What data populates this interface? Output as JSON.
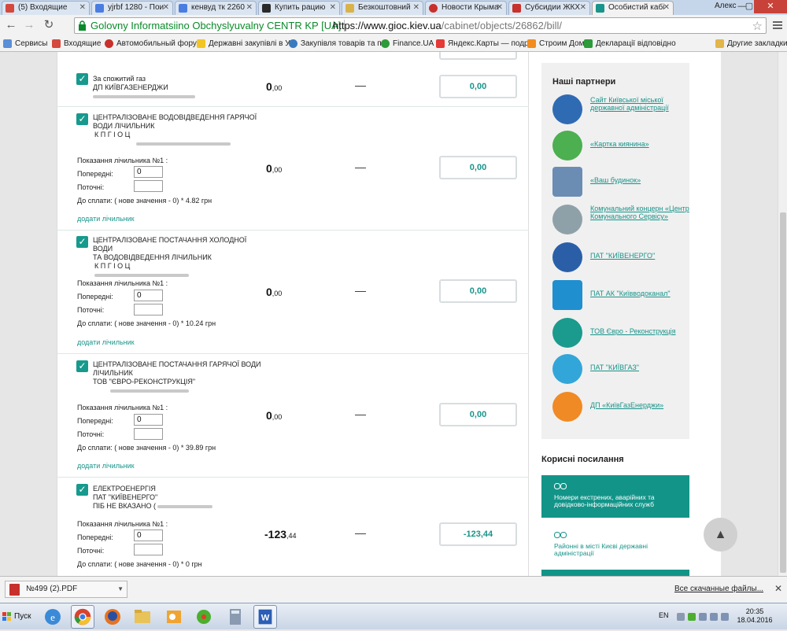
{
  "tabs": [
    {
      "label": "(5) Входящие",
      "color": "#d5483e"
    },
    {
      "label": "yjrbf 1280 - Пои",
      "color": "#4a7de2"
    },
    {
      "label": "кенвуд тк 2260",
      "color": "#4a7de2"
    },
    {
      "label": "Купить рацию",
      "color": "#2a2a2a"
    },
    {
      "label": "Безкоштовний",
      "color": "#d9b34a"
    },
    {
      "label": "Новости Крыма",
      "color": "#c8302c"
    },
    {
      "label": "Субсидии ЖКХ",
      "color": "#c8302c"
    },
    {
      "label": "Особистий кабі",
      "color": "#18948a"
    }
  ],
  "window": {
    "user": "Алекс",
    "min": "—",
    "max": "▢",
    "close": "✕"
  },
  "toolbar": {
    "back": "←",
    "forward": "→",
    "reload": "↻"
  },
  "address": {
    "site_identity": "Golovny Informatsiino Obchyslyuvalny CENTR KP [UA]",
    "url_main": "https://www.gioc.kiev.ua",
    "url_rest": "/cabinet/objects/26862/bill/",
    "star": "☆"
  },
  "bookmarks": [
    {
      "label": "Сервисы",
      "color": "#5b8fd8"
    },
    {
      "label": "Входящие",
      "color": "#d5483e"
    },
    {
      "label": "Автомобильный форум",
      "color": "#c8302c"
    },
    {
      "label": "Державні закупівлі в У",
      "color": "#f3c522"
    },
    {
      "label": "Закупівля товарів та п",
      "color": "#3a7bbf"
    },
    {
      "label": "Finance.UA",
      "color": "#2d9b3a"
    },
    {
      "label": "Яндекс.Карты — подр",
      "color": "#e53935"
    },
    {
      "label": "Строим Дом",
      "color": "#f28c1e"
    },
    {
      "label": "Декларації відповідно",
      "color": "#2d9b3a"
    },
    {
      "label": "Другие закладки",
      "color": "#e1b64a"
    }
  ],
  "rows": [
    {
      "checked": true,
      "service_l1": "За спожитий газ",
      "service_l2": "ДП КИЇВГАЗЕНЕРДЖИ",
      "amount_int": "0",
      "amount_dec": ",00",
      "dash": "—",
      "pay": "0,00"
    },
    {
      "checked": true,
      "service_l1": "ЦЕНТРАЛІЗОВАНЕ ВОДОВІДВЕДЕННЯ ГАРЯЧОЇ",
      "service_l2": "ВОДИ ЛІЧИЛЬНИК",
      "service_l3": "К П Г І О Ц",
      "meter": "Показання лічильника №1 :",
      "prev_label": "Попередні:",
      "prev_value": "0",
      "cur_label": "Поточні:",
      "cur_value": "",
      "formula": "До сплати: ( нове значення - 0) * 4.82 грн",
      "add_link": "додати лічильник",
      "amount_int": "0",
      "amount_dec": ",00",
      "dash": "—",
      "pay": "0,00"
    },
    {
      "checked": true,
      "service_l1": "ЦЕНТРАЛІЗОВАНЕ ПОСТАЧАННЯ ХОЛОДНОЇ ВОДИ",
      "service_l2": "ТА ВОДОВІДВЕДЕННЯ ЛІЧИЛЬНИК",
      "service_l3": "К П Г І О Ц",
      "meter": "Показання лічильника №1 :",
      "prev_label": "Попередні:",
      "prev_value": "0",
      "cur_label": "Поточні:",
      "cur_value": "",
      "formula": "До сплати: ( нове значення - 0) * 10.24 грн",
      "add_link": "додати лічильник",
      "amount_int": "0",
      "amount_dec": ",00",
      "dash": "—",
      "pay": "0,00"
    },
    {
      "checked": true,
      "service_l1": "ЦЕНТРАЛІЗОВАНЕ ПОСТАЧАННЯ ГАРЯЧОЇ ВОДИ",
      "service_l2": "ЛІЧИЛЬНИК",
      "service_l3": "ТОВ \"ЄВРО-РЕКОНСТРУКЦІЯ\"",
      "meter": "Показання лічильника №1 :",
      "prev_label": "Попередні:",
      "prev_value": "0",
      "cur_label": "Поточні:",
      "cur_value": "",
      "formula": "До сплати: ( нове значення - 0) * 39.89 грн",
      "add_link": "додати лічильник",
      "amount_int": "0",
      "amount_dec": ",00",
      "dash": "—",
      "pay": "0,00"
    },
    {
      "checked": true,
      "service_l1": "ЕЛЕКТРОЕНЕРГІЯ",
      "service_l2": "ПАТ \"КИЇВЕНЕРГО\"",
      "service_l3": "ПІБ НЕ ВКАЗАНО (",
      "meter": "Показання лічильника №1 :",
      "prev_label": "Попередні:",
      "prev_value": "0",
      "cur_label": "Поточні:",
      "cur_value": "",
      "formula": "До сплати: ( нове значення - 0) * 0 грн",
      "amount_int": "-123",
      "amount_dec": ",44",
      "dash": "—",
      "pay": "-123,44"
    }
  ],
  "partners": {
    "title": "Наші партнери",
    "items": [
      {
        "name": "Сайт Київської міської державної адміністрації",
        "color": "#2f6bb3",
        "icon": "kyiv-coat-of-arms-logo"
      },
      {
        "name": "«Картка киянина»",
        "color": "#4caf50",
        "icon": "kyiv-card-logo"
      },
      {
        "name": "«Ваш будинок»",
        "color": "#6b8db3",
        "icon": "building-logo"
      },
      {
        "name": "Комунальний концерн «Центр Комунального Сервісу»",
        "color": "#8fa1a8",
        "icon": "ccs-logo"
      },
      {
        "name": "ПАТ \"КИЇВЕНЕРГО\"",
        "color": "#2a5fa8",
        "icon": "kyivenergo-logo"
      },
      {
        "name": "ПАТ АК \"Київводоканал\"",
        "color": "#1f8fcf",
        "icon": "vodokanal-logo"
      },
      {
        "name": "ТОВ Євро - Реконструкція",
        "color": "#1a9b8e",
        "icon": "euro-reconstruction-logo"
      },
      {
        "name": "ПАТ \"КИЇВГАЗ\"",
        "color": "#33a6d9",
        "icon": "kyivgaz-logo"
      },
      {
        "name": "ДП «КиївГазЕнерджи»",
        "color": "#f08a24",
        "icon": "kyivgazenergy-logo"
      }
    ]
  },
  "useful_links": {
    "title": "Корисні посилання",
    "btn1": "Номери екстрених, аварійних та довідково-інформаційних служб",
    "btn2": "Районні в місті Києві державні адміністрації"
  },
  "downloads": {
    "file": "№499 (2).PDF",
    "show_all": "Все скачанные файлы...",
    "close": "✕"
  },
  "taskbar": {
    "start": "Пуск",
    "lang": "EN",
    "time": "20:35",
    "date": "18.04.2016"
  },
  "colors": {
    "accent": "#18948a",
    "checkbox": "#179a8d"
  }
}
